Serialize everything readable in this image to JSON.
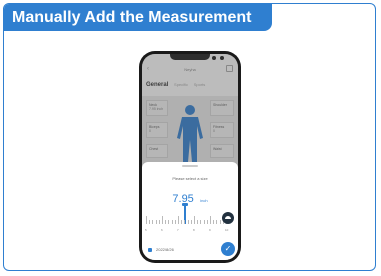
{
  "banner": {
    "title": "Manually Add the Measurement"
  },
  "phone": {
    "header": {
      "back": "‹",
      "title": "Neyha"
    },
    "tabs": {
      "active": "General",
      "tab2": "Specific",
      "tab3": "Sports"
    },
    "cards": {
      "neck": {
        "label": "Neck",
        "value": "7.95 inch"
      },
      "shoulder": {
        "label": "Shoulder"
      },
      "biceps": {
        "label": "Biceps",
        "value": "0"
      },
      "fitness": {
        "label": "Fitness",
        "value": "0"
      },
      "chest": {
        "label": "Chest"
      },
      "waist": {
        "label": "Waist"
      }
    },
    "sheet": {
      "prompt": "Please select a size",
      "value": "7.95",
      "unit": "inch",
      "ruler_labels": [
        "5",
        "6",
        "7",
        "8",
        "9",
        "10"
      ],
      "date": "2022/8/26",
      "confirm": "✓"
    }
  },
  "colors": {
    "accent": "#2f7fd0",
    "dark": "#22313f"
  }
}
